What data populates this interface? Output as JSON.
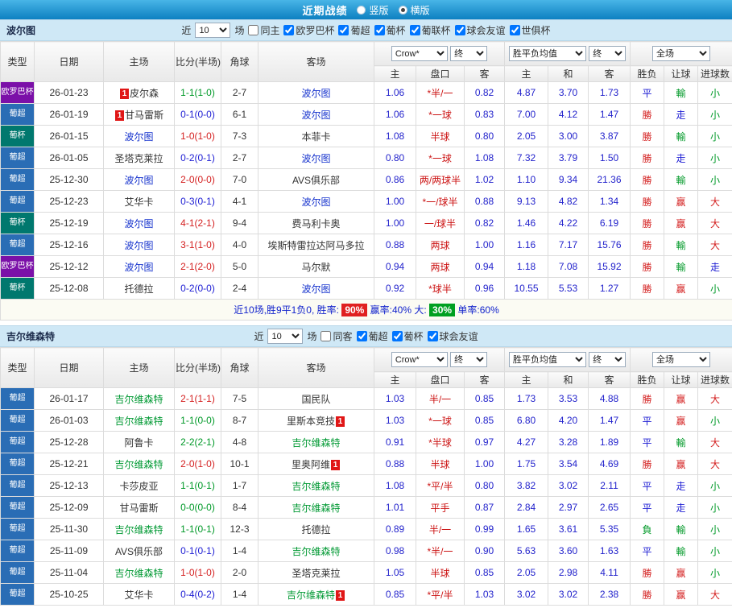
{
  "topbar": {
    "title": "近期战绩",
    "radio_vertical": "竖版",
    "radio_horizontal": "横版",
    "selected": "横版"
  },
  "table_headers": {
    "type": "类型",
    "date": "日期",
    "home": "主场",
    "score": "比分(半场)",
    "corner": "角球",
    "away": "客场",
    "odds_home": "主",
    "odds_handicap": "盘口",
    "odds_away": "客",
    "avg_home": "主",
    "avg_draw": "和",
    "avg_away": "客",
    "wdl": "胜负",
    "handicap_result": "让球",
    "goals_result": "进球数",
    "select_bookmaker": "Crow*",
    "select_final": "终",
    "select_avg": "胜平负均值",
    "select_scope": "全场"
  },
  "colors": {
    "europa": "#7b10a8",
    "liga": "#2a6db5",
    "cup": "#00786e",
    "home_focus": "#1532cd",
    "away_focus": "#009933"
  },
  "sections": [
    {
      "team": "波尔图",
      "focus_color": "#1532cd",
      "filter": {
        "near": "近",
        "count": "10",
        "games": "场",
        "same": {
          "label": "同主",
          "checked": false
        },
        "leagues": [
          {
            "label": "欧罗巴杯",
            "checked": true
          },
          {
            "label": "葡超",
            "checked": true
          },
          {
            "label": "葡杯",
            "checked": true
          },
          {
            "label": "葡联杯",
            "checked": true
          },
          {
            "label": "球会友谊",
            "checked": true
          },
          {
            "label": "世俱杯",
            "checked": true
          }
        ]
      },
      "rows": [
        {
          "type": "欧罗巴杯",
          "type_color": "#7b10a8",
          "date": "26-01-23",
          "home": {
            "t": "皮尔森",
            "focus": false,
            "badge": "before"
          },
          "score": {
            "t": "1-1(1-0)",
            "c": "green"
          },
          "corner": "2-7",
          "away": {
            "t": "波尔图",
            "focus": true
          },
          "odd_home": "1.06",
          "handicap": "*半/一",
          "odd_away": "0.82",
          "avg_h": "4.87",
          "avg_d": "3.70",
          "avg_a": "1.73",
          "wdl": {
            "t": "平",
            "c": "blue"
          },
          "handi": {
            "t": "輸",
            "c": "green"
          },
          "goals": {
            "t": "小",
            "c": "green"
          }
        },
        {
          "type": "葡超",
          "type_color": "#2a6db5",
          "date": "26-01-19",
          "home": {
            "t": "甘马雷斯",
            "focus": false,
            "badge": "before"
          },
          "score": {
            "t": "0-1(0-0)",
            "c": "blue"
          },
          "corner": "6-1",
          "away": {
            "t": "波尔图",
            "focus": true
          },
          "odd_home": "1.06",
          "handicap": "*一球",
          "odd_away": "0.83",
          "avg_h": "7.00",
          "avg_d": "4.12",
          "avg_a": "1.47",
          "wdl": {
            "t": "勝",
            "c": "red"
          },
          "handi": {
            "t": "走",
            "c": "blue"
          },
          "goals": {
            "t": "小",
            "c": "green"
          }
        },
        {
          "type": "葡杯",
          "type_color": "#00786e",
          "date": "26-01-15",
          "home": {
            "t": "波尔图",
            "focus": true
          },
          "score": {
            "t": "1-0(1-0)",
            "c": "red"
          },
          "corner": "7-3",
          "away": {
            "t": "本菲卡",
            "focus": false
          },
          "odd_home": "1.08",
          "handicap": "半球",
          "odd_away": "0.80",
          "avg_h": "2.05",
          "avg_d": "3.00",
          "avg_a": "3.87",
          "wdl": {
            "t": "勝",
            "c": "red"
          },
          "handi": {
            "t": "輸",
            "c": "green"
          },
          "goals": {
            "t": "小",
            "c": "green"
          }
        },
        {
          "type": "葡超",
          "type_color": "#2a6db5",
          "date": "26-01-05",
          "home": {
            "t": "圣塔克莱拉",
            "focus": false
          },
          "score": {
            "t": "0-2(0-1)",
            "c": "blue"
          },
          "corner": "2-7",
          "away": {
            "t": "波尔图",
            "focus": true
          },
          "odd_home": "0.80",
          "handicap": "*一球",
          "odd_away": "1.08",
          "avg_h": "7.32",
          "avg_d": "3.79",
          "avg_a": "1.50",
          "wdl": {
            "t": "勝",
            "c": "red"
          },
          "handi": {
            "t": "走",
            "c": "blue"
          },
          "goals": {
            "t": "小",
            "c": "green"
          }
        },
        {
          "type": "葡超",
          "type_color": "#2a6db5",
          "date": "25-12-30",
          "home": {
            "t": "波尔图",
            "focus": true
          },
          "score": {
            "t": "2-0(0-0)",
            "c": "red"
          },
          "corner": "7-0",
          "away": {
            "t": "AVS俱乐部",
            "focus": false
          },
          "odd_home": "0.86",
          "handicap": "两/两球半",
          "odd_away": "1.02",
          "avg_h": "1.10",
          "avg_d": "9.34",
          "avg_a": "21.36",
          "wdl": {
            "t": "勝",
            "c": "red"
          },
          "handi": {
            "t": "輸",
            "c": "green"
          },
          "goals": {
            "t": "小",
            "c": "green"
          }
        },
        {
          "type": "葡超",
          "type_color": "#2a6db5",
          "date": "25-12-23",
          "home": {
            "t": "艾华卡",
            "focus": false
          },
          "score": {
            "t": "0-3(0-1)",
            "c": "blue"
          },
          "corner": "4-1",
          "away": {
            "t": "波尔图",
            "focus": true
          },
          "odd_home": "1.00",
          "handicap": "*一/球半",
          "odd_away": "0.88",
          "avg_h": "9.13",
          "avg_d": "4.82",
          "avg_a": "1.34",
          "wdl": {
            "t": "勝",
            "c": "red"
          },
          "handi": {
            "t": "赢",
            "c": "red"
          },
          "goals": {
            "t": "大",
            "c": "red"
          }
        },
        {
          "type": "葡杯",
          "type_color": "#00786e",
          "date": "25-12-19",
          "home": {
            "t": "波尔图",
            "focus": true
          },
          "score": {
            "t": "4-1(2-1)",
            "c": "red"
          },
          "corner": "9-4",
          "away": {
            "t": "费马利卡奥",
            "focus": false
          },
          "odd_home": "1.00",
          "handicap": "一/球半",
          "odd_away": "0.82",
          "avg_h": "1.46",
          "avg_d": "4.22",
          "avg_a": "6.19",
          "wdl": {
            "t": "勝",
            "c": "red"
          },
          "handi": {
            "t": "赢",
            "c": "red"
          },
          "goals": {
            "t": "大",
            "c": "red"
          }
        },
        {
          "type": "葡超",
          "type_color": "#2a6db5",
          "date": "25-12-16",
          "home": {
            "t": "波尔图",
            "focus": true
          },
          "score": {
            "t": "3-1(1-0)",
            "c": "red"
          },
          "corner": "4-0",
          "away": {
            "t": "埃斯特雷拉达阿马多拉",
            "focus": false
          },
          "odd_home": "0.88",
          "handicap": "两球",
          "odd_away": "1.00",
          "avg_h": "1.16",
          "avg_d": "7.17",
          "avg_a": "15.76",
          "wdl": {
            "t": "勝",
            "c": "red"
          },
          "handi": {
            "t": "輸",
            "c": "green"
          },
          "goals": {
            "t": "大",
            "c": "red"
          }
        },
        {
          "type": "欧罗巴杯",
          "type_color": "#7b10a8",
          "date": "25-12-12",
          "home": {
            "t": "波尔图",
            "focus": true
          },
          "score": {
            "t": "2-1(2-0)",
            "c": "red"
          },
          "corner": "5-0",
          "away": {
            "t": "马尔默",
            "focus": false
          },
          "odd_home": "0.94",
          "handicap": "两球",
          "odd_away": "0.94",
          "avg_h": "1.18",
          "avg_d": "7.08",
          "avg_a": "15.92",
          "wdl": {
            "t": "勝",
            "c": "red"
          },
          "handi": {
            "t": "輸",
            "c": "green"
          },
          "goals": {
            "t": "走",
            "c": "blue"
          }
        },
        {
          "type": "葡杯",
          "type_color": "#00786e",
          "date": "25-12-08",
          "home": {
            "t": "托德拉",
            "focus": false
          },
          "score": {
            "t": "0-2(0-0)",
            "c": "blue"
          },
          "corner": "2-4",
          "away": {
            "t": "波尔图",
            "focus": true
          },
          "odd_home": "0.92",
          "handicap": "*球半",
          "odd_away": "0.96",
          "avg_h": "10.55",
          "avg_d": "5.53",
          "avg_a": "1.27",
          "wdl": {
            "t": "勝",
            "c": "red"
          },
          "handi": {
            "t": "赢",
            "c": "red"
          },
          "goals": {
            "t": "小",
            "c": "green"
          }
        }
      ],
      "summary": {
        "part1": "近10场,胜9平1负0, 胜率: ",
        "win_rate": "90%",
        "part2": " 赢率:40%  大: ",
        "goal_rate": "30%",
        "part3": " 单率:60%"
      }
    },
    {
      "team": "吉尔维森特",
      "focus_color": "#009933",
      "filter": {
        "near": "近",
        "count": "10",
        "games": "场",
        "same": {
          "label": "同客",
          "checked": false
        },
        "leagues": [
          {
            "label": "葡超",
            "checked": true
          },
          {
            "label": "葡杯",
            "checked": true
          },
          {
            "label": "球会友谊",
            "checked": true
          }
        ]
      },
      "rows": [
        {
          "type": "葡超",
          "type_color": "#2a6db5",
          "date": "26-01-17",
          "home": {
            "t": "吉尔维森特",
            "focus": true
          },
          "score": {
            "t": "2-1(1-1)",
            "c": "red"
          },
          "corner": "7-5",
          "away": {
            "t": "国民队",
            "focus": false
          },
          "odd_home": "1.03",
          "handicap": "半/一",
          "odd_away": "0.85",
          "avg_h": "1.73",
          "avg_d": "3.53",
          "avg_a": "4.88",
          "wdl": {
            "t": "勝",
            "c": "red"
          },
          "handi": {
            "t": "赢",
            "c": "red"
          },
          "goals": {
            "t": "大",
            "c": "red"
          }
        },
        {
          "type": "葡超",
          "type_color": "#2a6db5",
          "date": "26-01-03",
          "home": {
            "t": "吉尔维森特",
            "focus": true
          },
          "score": {
            "t": "1-1(0-0)",
            "c": "green"
          },
          "corner": "8-7",
          "away": {
            "t": "里斯本竞技",
            "focus": false,
            "badge": "after"
          },
          "odd_home": "1.03",
          "handicap": "*一球",
          "odd_away": "0.85",
          "avg_h": "6.80",
          "avg_d": "4.20",
          "avg_a": "1.47",
          "wdl": {
            "t": "平",
            "c": "blue"
          },
          "handi": {
            "t": "赢",
            "c": "red"
          },
          "goals": {
            "t": "小",
            "c": "green"
          }
        },
        {
          "type": "葡超",
          "type_color": "#2a6db5",
          "date": "25-12-28",
          "home": {
            "t": "阿鲁卡",
            "focus": false
          },
          "score": {
            "t": "2-2(2-1)",
            "c": "green"
          },
          "corner": "4-8",
          "away": {
            "t": "吉尔维森特",
            "focus": true
          },
          "odd_home": "0.91",
          "handicap": "*半球",
          "odd_away": "0.97",
          "avg_h": "4.27",
          "avg_d": "3.28",
          "avg_a": "1.89",
          "wdl": {
            "t": "平",
            "c": "blue"
          },
          "handi": {
            "t": "輸",
            "c": "green"
          },
          "goals": {
            "t": "大",
            "c": "red"
          }
        },
        {
          "type": "葡超",
          "type_color": "#2a6db5",
          "date": "25-12-21",
          "home": {
            "t": "吉尔维森特",
            "focus": true
          },
          "score": {
            "t": "2-0(1-0)",
            "c": "red"
          },
          "corner": "10-1",
          "away": {
            "t": "里奥阿维",
            "focus": false,
            "badge": "after"
          },
          "odd_home": "0.88",
          "handicap": "半球",
          "odd_away": "1.00",
          "avg_h": "1.75",
          "avg_d": "3.54",
          "avg_a": "4.69",
          "wdl": {
            "t": "勝",
            "c": "red"
          },
          "handi": {
            "t": "赢",
            "c": "red"
          },
          "goals": {
            "t": "大",
            "c": "red"
          }
        },
        {
          "type": "葡超",
          "type_color": "#2a6db5",
          "date": "25-12-13",
          "home": {
            "t": "卡莎皮亚",
            "focus": false
          },
          "score": {
            "t": "1-1(0-1)",
            "c": "green"
          },
          "corner": "1-7",
          "away": {
            "t": "吉尔维森特",
            "focus": true
          },
          "odd_home": "1.08",
          "handicap": "*平/半",
          "odd_away": "0.80",
          "avg_h": "3.82",
          "avg_d": "3.02",
          "avg_a": "2.11",
          "wdl": {
            "t": "平",
            "c": "blue"
          },
          "handi": {
            "t": "走",
            "c": "blue"
          },
          "goals": {
            "t": "小",
            "c": "green"
          }
        },
        {
          "type": "葡超",
          "type_color": "#2a6db5",
          "date": "25-12-09",
          "home": {
            "t": "甘马雷斯",
            "focus": false
          },
          "score": {
            "t": "0-0(0-0)",
            "c": "green"
          },
          "corner": "8-4",
          "away": {
            "t": "吉尔维森特",
            "focus": true
          },
          "odd_home": "1.01",
          "handicap": "平手",
          "odd_away": "0.87",
          "avg_h": "2.84",
          "avg_d": "2.97",
          "avg_a": "2.65",
          "wdl": {
            "t": "平",
            "c": "blue"
          },
          "handi": {
            "t": "走",
            "c": "blue"
          },
          "goals": {
            "t": "小",
            "c": "green"
          }
        },
        {
          "type": "葡超",
          "type_color": "#2a6db5",
          "date": "25-11-30",
          "home": {
            "t": "吉尔维森特",
            "focus": true
          },
          "score": {
            "t": "1-1(0-1)",
            "c": "green"
          },
          "corner": "12-3",
          "away": {
            "t": "托德拉",
            "focus": false
          },
          "odd_home": "0.89",
          "handicap": "半/一",
          "odd_away": "0.99",
          "avg_h": "1.65",
          "avg_d": "3.61",
          "avg_a": "5.35",
          "wdl": {
            "t": "負",
            "c": "green"
          },
          "handi": {
            "t": "輸",
            "c": "green"
          },
          "goals": {
            "t": "小",
            "c": "green"
          }
        },
        {
          "type": "葡超",
          "type_color": "#2a6db5",
          "date": "25-11-09",
          "home": {
            "t": "AVS俱乐部",
            "focus": false
          },
          "score": {
            "t": "0-1(0-1)",
            "c": "blue"
          },
          "corner": "1-4",
          "away": {
            "t": "吉尔维森特",
            "focus": true
          },
          "odd_home": "0.98",
          "handicap": "*半/一",
          "odd_away": "0.90",
          "avg_h": "5.63",
          "avg_d": "3.60",
          "avg_a": "1.63",
          "wdl": {
            "t": "平",
            "c": "blue"
          },
          "handi": {
            "t": "輸",
            "c": "green"
          },
          "goals": {
            "t": "小",
            "c": "green"
          }
        },
        {
          "type": "葡超",
          "type_color": "#2a6db5",
          "date": "25-11-04",
          "home": {
            "t": "吉尔维森特",
            "focus": true
          },
          "score": {
            "t": "1-0(1-0)",
            "c": "red"
          },
          "corner": "2-0",
          "away": {
            "t": "圣塔克莱拉",
            "focus": false
          },
          "odd_home": "1.05",
          "handicap": "半球",
          "odd_away": "0.85",
          "avg_h": "2.05",
          "avg_d": "2.98",
          "avg_a": "4.11",
          "wdl": {
            "t": "勝",
            "c": "red"
          },
          "handi": {
            "t": "赢",
            "c": "red"
          },
          "goals": {
            "t": "小",
            "c": "green"
          }
        },
        {
          "type": "葡超",
          "type_color": "#2a6db5",
          "date": "25-10-25",
          "home": {
            "t": "艾华卡",
            "focus": false
          },
          "score": {
            "t": "0-4(0-2)",
            "c": "blue"
          },
          "corner": "1-4",
          "away": {
            "t": "吉尔维森特",
            "focus": true,
            "badge": "after"
          },
          "odd_home": "0.85",
          "handicap": "*平/半",
          "odd_away": "1.03",
          "avg_h": "3.02",
          "avg_d": "3.02",
          "avg_a": "2.38",
          "wdl": {
            "t": "勝",
            "c": "red"
          },
          "handi": {
            "t": "赢",
            "c": "red"
          },
          "goals": {
            "t": "大",
            "c": "red"
          }
        }
      ]
    }
  ]
}
